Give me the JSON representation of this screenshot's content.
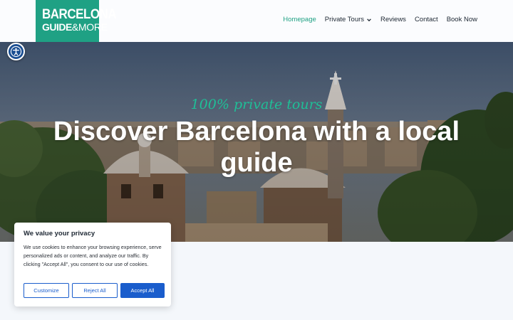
{
  "logo": {
    "line1": "BARCELONA",
    "line2_strong": "GUIDE",
    "line2_light": "&MORE"
  },
  "nav": {
    "items": [
      {
        "label": "Homepage",
        "active": true
      },
      {
        "label": "Private Tours",
        "dropdown": true
      },
      {
        "label": "Reviews"
      },
      {
        "label": "Contact"
      },
      {
        "label": "Book Now"
      }
    ]
  },
  "hero": {
    "tagline": "100% private tours",
    "title": "Discover Barcelona with a local guide"
  },
  "cookie_banner": {
    "title": "We value your privacy",
    "text": "We use cookies to enhance your browsing experience, serve personalized ads or content, and analyze our traffic. By clicking \"Accept All\", you consent to our use of cookies.",
    "customize_label": "Customize",
    "reject_label": "Reject All",
    "accept_label": "Accept All"
  },
  "colors": {
    "brand": "#1fa184",
    "button_blue": "#1a5dcc",
    "a11y_blue": "#1b4f93"
  },
  "icons": {
    "accessibility": "accessibility-icon",
    "dropdown": "chevron-down-icon"
  }
}
